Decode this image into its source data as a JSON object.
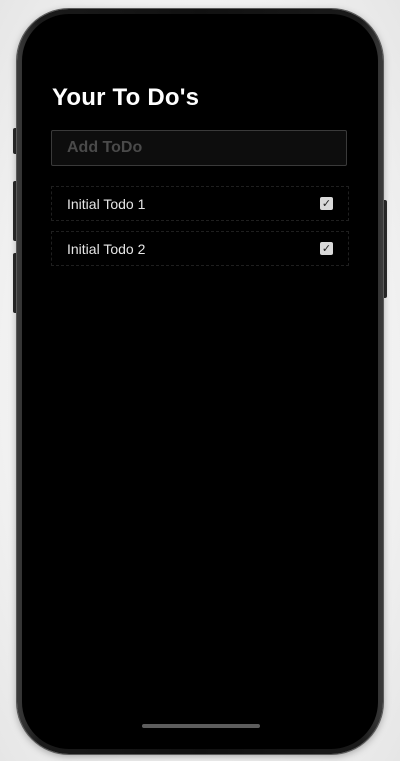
{
  "header": {
    "title": "Your To Do's"
  },
  "add_todo": {
    "placeholder": "Add ToDo",
    "value": ""
  },
  "todos": [
    {
      "label": "Initial Todo 1",
      "checked": true
    },
    {
      "label": "Initial Todo 2",
      "checked": true
    }
  ],
  "icons": {
    "checkbox": "checkbox-checked-icon"
  },
  "colors": {
    "background": "#000000",
    "title": "#ffffff",
    "placeholder": "#4a4a4a",
    "item_text": "#e6e6e6",
    "checkbox_fill": "#d9d9d9"
  }
}
